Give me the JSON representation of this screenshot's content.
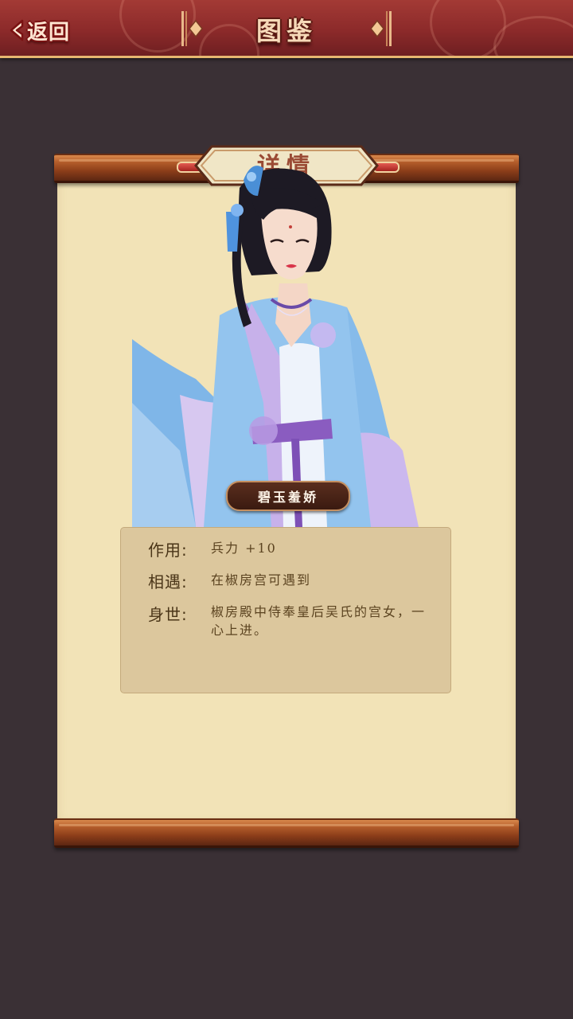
{
  "header": {
    "back_label": "返回",
    "title": "图鉴"
  },
  "scroll": {
    "title": "详情"
  },
  "character": {
    "name": "碧玉羞娇"
  },
  "info": {
    "rows": [
      {
        "label": "作用:",
        "value": "兵力 +10"
      },
      {
        "label": "相遇:",
        "value": "在椒房宫可遇到"
      },
      {
        "label": "身世:",
        "value": "椒房殿中侍奉皇后吴氏的宫女，一心上进。"
      }
    ]
  },
  "colors": {
    "background": "#3a3035",
    "header_red": "#8c2a2a",
    "paper": "#f2e3b7",
    "info_box": "#dcc79d",
    "name_plate": "#4a2416"
  },
  "icons": [
    "back-arrow-icon",
    "title-left-ornament-icon",
    "title-right-ornament-icon"
  ]
}
